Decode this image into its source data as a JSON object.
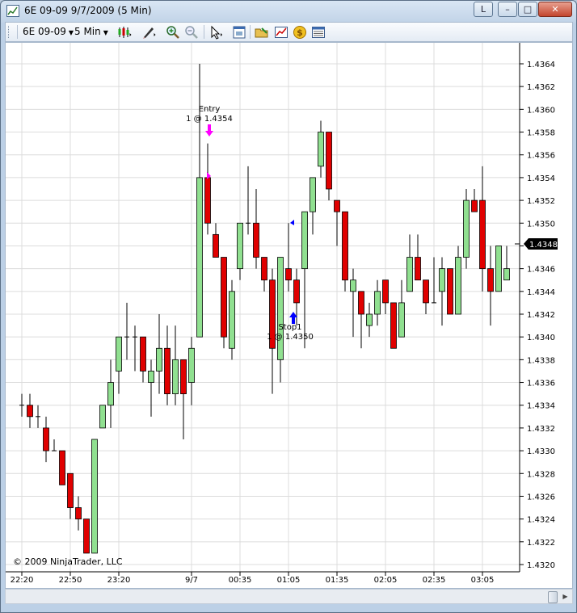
{
  "window": {
    "title": "6E 09-09  9/7/2009 (5 Min)",
    "buttons": {
      "help": "L",
      "minimize": "–",
      "maximize": "□",
      "close": "✕"
    }
  },
  "toolbar": {
    "instrument": "6E 09-09",
    "interval": "5 Min",
    "icons": [
      "bar-type-icon",
      "drawing-tools-icon",
      "zoom-in-icon",
      "zoom-out-icon",
      "cursor-icon",
      "data-box-icon",
      "open-icon",
      "chart-properties-icon",
      "order-entry-icon",
      "data-table-icon"
    ]
  },
  "chart": {
    "copyright": "© 2009 NinjaTrader, LLC",
    "current_price_label": "1.4348",
    "colors": {
      "up": "#90e090",
      "down": "#e00000",
      "grid": "#dcdcdc",
      "entry_arrow": "#ff00ff",
      "stop_arrow": "#0000ff",
      "price_tag": "#000000"
    },
    "markers": {
      "entry": {
        "title": "Entry",
        "detail": "1 @ 1.4354"
      },
      "stop": {
        "title": "Stop1",
        "detail": "1 @ 1.4350"
      }
    }
  },
  "chart_data": {
    "type": "candlestick",
    "y_ticks": [
      "1.4364",
      "1.4362",
      "1.4360",
      "1.4358",
      "1.4356",
      "1.4354",
      "1.4352",
      "1.4350",
      "1.4348",
      "1.4346",
      "1.4344",
      "1.4342",
      "1.4340",
      "1.4338",
      "1.4336",
      "1.4334",
      "1.4332",
      "1.4330",
      "1.4328",
      "1.4326",
      "1.4324",
      "1.4322",
      "1.4320"
    ],
    "x_ticks": [
      {
        "label": "22:20",
        "bar": 0
      },
      {
        "label": "22:50",
        "bar": 6
      },
      {
        "label": "23:20",
        "bar": 12
      },
      {
        "label": "9/7",
        "bar": 21
      },
      {
        "label": "00:35",
        "bar": 27
      },
      {
        "label": "01:05",
        "bar": 33
      },
      {
        "label": "01:35",
        "bar": 39
      },
      {
        "label": "02:05",
        "bar": 45
      },
      {
        "label": "02:35",
        "bar": 51
      },
      {
        "label": "03:05",
        "bar": 57
      }
    ],
    "ylim": [
      1.432,
      1.4364
    ],
    "bars": [
      {
        "o": 1.4334,
        "h": 1.4335,
        "l": 1.4333,
        "c": 1.4334
      },
      {
        "o": 1.4334,
        "h": 1.4335,
        "l": 1.4332,
        "c": 1.4333
      },
      {
        "o": 1.4333,
        "h": 1.4334,
        "l": 1.4332,
        "c": 1.4333
      },
      {
        "o": 1.4332,
        "h": 1.4333,
        "l": 1.4329,
        "c": 1.433
      },
      {
        "o": 1.433,
        "h": 1.4331,
        "l": 1.433,
        "c": 1.433
      },
      {
        "o": 1.433,
        "h": 1.433,
        "l": 1.4327,
        "c": 1.4327
      },
      {
        "o": 1.4328,
        "h": 1.4328,
        "l": 1.4324,
        "c": 1.4325
      },
      {
        "o": 1.4325,
        "h": 1.4326,
        "l": 1.4323,
        "c": 1.4324
      },
      {
        "o": 1.4324,
        "h": 1.4324,
        "l": 1.4321,
        "c": 1.4321
      },
      {
        "o": 1.4321,
        "h": 1.4331,
        "l": 1.4321,
        "c": 1.4331
      },
      {
        "o": 1.4332,
        "h": 1.4334,
        "l": 1.4332,
        "c": 1.4334
      },
      {
        "o": 1.4334,
        "h": 1.4338,
        "l": 1.4332,
        "c": 1.4336
      },
      {
        "o": 1.4337,
        "h": 1.434,
        "l": 1.4335,
        "c": 1.434
      },
      {
        "o": 1.434,
        "h": 1.4343,
        "l": 1.4338,
        "c": 1.434
      },
      {
        "o": 1.434,
        "h": 1.4341,
        "l": 1.4337,
        "c": 1.434
      },
      {
        "o": 1.434,
        "h": 1.434,
        "l": 1.4336,
        "c": 1.4337
      },
      {
        "o": 1.4336,
        "h": 1.4338,
        "l": 1.4333,
        "c": 1.4337
      },
      {
        "o": 1.4337,
        "h": 1.4342,
        "l": 1.4335,
        "c": 1.4339
      },
      {
        "o": 1.4339,
        "h": 1.4341,
        "l": 1.4334,
        "c": 1.4335
      },
      {
        "o": 1.4335,
        "h": 1.4341,
        "l": 1.4334,
        "c": 1.4338
      },
      {
        "o": 1.4338,
        "h": 1.4338,
        "l": 1.4331,
        "c": 1.4335
      },
      {
        "o": 1.4336,
        "h": 1.434,
        "l": 1.4334,
        "c": 1.4339
      },
      {
        "o": 1.434,
        "h": 1.4364,
        "l": 1.434,
        "c": 1.4354
      },
      {
        "o": 1.4354,
        "h": 1.4357,
        "l": 1.4349,
        "c": 1.435
      },
      {
        "o": 1.4349,
        "h": 1.435,
        "l": 1.4347,
        "c": 1.4347
      },
      {
        "o": 1.4347,
        "h": 1.4347,
        "l": 1.4339,
        "c": 1.434
      },
      {
        "o": 1.4339,
        "h": 1.4345,
        "l": 1.4338,
        "c": 1.4344
      },
      {
        "o": 1.4346,
        "h": 1.435,
        "l": 1.4345,
        "c": 1.435
      },
      {
        "o": 1.435,
        "h": 1.4355,
        "l": 1.4349,
        "c": 1.435
      },
      {
        "o": 1.435,
        "h": 1.4353,
        "l": 1.4346,
        "c": 1.4347
      },
      {
        "o": 1.4347,
        "h": 1.4347,
        "l": 1.4344,
        "c": 1.4345
      },
      {
        "o": 1.4345,
        "h": 1.4346,
        "l": 1.4335,
        "c": 1.4339
      },
      {
        "o": 1.4338,
        "h": 1.4347,
        "l": 1.4336,
        "c": 1.4347
      },
      {
        "o": 1.4346,
        "h": 1.435,
        "l": 1.4344,
        "c": 1.4345
      },
      {
        "o": 1.4345,
        "h": 1.4346,
        "l": 1.4341,
        "c": 1.4343
      },
      {
        "o": 1.4346,
        "h": 1.435,
        "l": 1.4339,
        "c": 1.4351
      },
      {
        "o": 1.4351,
        "h": 1.4354,
        "l": 1.4349,
        "c": 1.4354
      },
      {
        "o": 1.4355,
        "h": 1.4359,
        "l": 1.4354,
        "c": 1.4358
      },
      {
        "o": 1.4358,
        "h": 1.4358,
        "l": 1.4352,
        "c": 1.4353
      },
      {
        "o": 1.4352,
        "h": 1.4352,
        "l": 1.4348,
        "c": 1.4351
      },
      {
        "o": 1.4351,
        "h": 1.4351,
        "l": 1.4344,
        "c": 1.4345
      },
      {
        "o": 1.4344,
        "h": 1.4346,
        "l": 1.434,
        "c": 1.4345
      },
      {
        "o": 1.4344,
        "h": 1.4344,
        "l": 1.4339,
        "c": 1.4342
      },
      {
        "o": 1.4341,
        "h": 1.4343,
        "l": 1.434,
        "c": 1.4342
      },
      {
        "o": 1.4342,
        "h": 1.4345,
        "l": 1.4341,
        "c": 1.4344
      },
      {
        "o": 1.4345,
        "h": 1.4345,
        "l": 1.4342,
        "c": 1.4343
      },
      {
        "o": 1.4343,
        "h": 1.4343,
        "l": 1.4339,
        "c": 1.4339
      },
      {
        "o": 1.434,
        "h": 1.4345,
        "l": 1.434,
        "c": 1.4343
      },
      {
        "o": 1.4344,
        "h": 1.4349,
        "l": 1.4344,
        "c": 1.4347
      },
      {
        "o": 1.4347,
        "h": 1.4349,
        "l": 1.4345,
        "c": 1.4345
      },
      {
        "o": 1.4345,
        "h": 1.4345,
        "l": 1.4342,
        "c": 1.4343
      },
      {
        "o": 1.4343,
        "h": 1.4347,
        "l": 1.4343,
        "c": 1.4343
      },
      {
        "o": 1.4344,
        "h": 1.4347,
        "l": 1.4341,
        "c": 1.4346
      },
      {
        "o": 1.4346,
        "h": 1.4346,
        "l": 1.4342,
        "c": 1.4342
      },
      {
        "o": 1.4342,
        "h": 1.4348,
        "l": 1.4342,
        "c": 1.4347
      },
      {
        "o": 1.4347,
        "h": 1.4353,
        "l": 1.4346,
        "c": 1.4352
      },
      {
        "o": 1.4352,
        "h": 1.4353,
        "l": 1.4351,
        "c": 1.4351
      },
      {
        "o": 1.4352,
        "h": 1.4355,
        "l": 1.4344,
        "c": 1.4346
      },
      {
        "o": 1.4346,
        "h": 1.4348,
        "l": 1.4341,
        "c": 1.4344
      },
      {
        "o": 1.4344,
        "h": 1.4348,
        "l": 1.4344,
        "c": 1.4348
      },
      {
        "o": 1.4345,
        "h": 1.4348,
        "l": 1.4345,
        "c": 1.4346
      }
    ]
  }
}
